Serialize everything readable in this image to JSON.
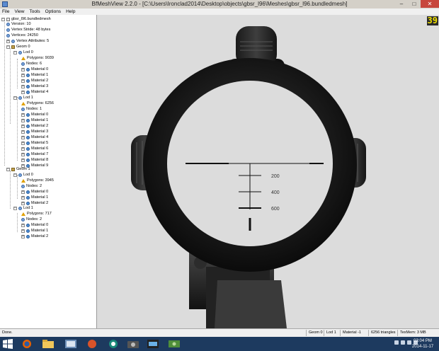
{
  "window": {
    "title": "BfMeshView 2.2.0 - [C:\\Users\\Ironclad2014\\Desktop\\objects\\gbsr_l96\\Meshes\\gbsr_l96.bundledmesh]",
    "minimize_glyph": "–",
    "maximize_glyph": "□",
    "close_glyph": "✕"
  },
  "menu": [
    "File",
    "View",
    "Tools",
    "Options",
    "Help"
  ],
  "tree": {
    "root": "gbsr_l96.bundledmesh",
    "version": "Version: 10",
    "stride": "Vertex Stride: 48 bytes",
    "vertices": "Vertices: 24250",
    "attributes": "Vertex Attributes: 5",
    "geom0": {
      "label": "Geom 0",
      "lod0": {
        "label": "Lod 0",
        "polygons": "Polygons: 9039",
        "nodes": "Nodes: 6",
        "materials": [
          "Material 0",
          "Material 1",
          "Material 2",
          "Material 3",
          "Material 4"
        ]
      },
      "lod1": {
        "label": "Lod 1",
        "polygons": "Polygons: 6256",
        "nodes": "Nodes: 1",
        "materials": [
          "Material 0",
          "Material 1",
          "Material 2",
          "Material 3",
          "Material 4",
          "Material 5",
          "Material 6",
          "Material 7",
          "Material 8",
          "Material 9"
        ]
      }
    },
    "geom1": {
      "label": "Geom 1",
      "lod0": {
        "label": "Lod 0",
        "polygons": "Polygons: 3945",
        "nodes": "Nodes: 2",
        "materials": [
          "Material 0",
          "Material 1",
          "Material 2"
        ]
      },
      "lod1": {
        "label": "Lod 1",
        "polygons": "Polygons: 717",
        "nodes": "Nodes: 2",
        "materials": [
          "Material 0",
          "Material 1",
          "Material 2"
        ]
      }
    }
  },
  "viewport": {
    "fps": "39",
    "reticle_labels": [
      "200",
      "400",
      "600"
    ],
    "background": "#dcdcdc"
  },
  "status": {
    "left": "Done.",
    "geom": "Geom 0",
    "lod": "Lod 1",
    "material": "Material -1",
    "triangles": "6256 triangles",
    "texmem": "TexMem: 3 MB"
  },
  "taskbar": {
    "apps": [
      "firefox-icon",
      "file-explorer-icon",
      "photo-viewer-icon",
      "ball-icon",
      "green-app-icon",
      "camera-icon",
      "cpu-z-icon",
      "money-icon"
    ],
    "time": "03:04 PM",
    "date": "2014-11-17",
    "bg": "#1d3a5f"
  }
}
